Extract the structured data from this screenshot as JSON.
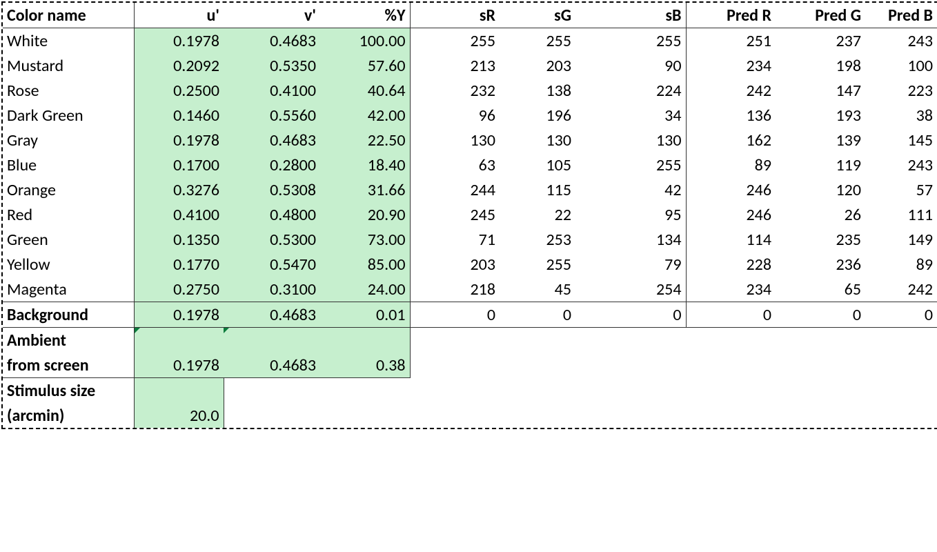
{
  "chart_data": {
    "type": "table",
    "headers": [
      "Color name",
      "u'",
      "v'",
      "%Y",
      "sR",
      "sG",
      "sB",
      "Pred R",
      "Pred G",
      "Pred B"
    ],
    "rows": [
      {
        "name": "White",
        "u": "0.1978",
        "v": "0.4683",
        "y": "100.00",
        "sR": "255",
        "sG": "255",
        "sB": "255",
        "pR": "251",
        "pG": "237",
        "pB": "243"
      },
      {
        "name": "Mustard",
        "u": "0.2092",
        "v": "0.5350",
        "y": "57.60",
        "sR": "213",
        "sG": "203",
        "sB": "90",
        "pR": "234",
        "pG": "198",
        "pB": "100"
      },
      {
        "name": "Rose",
        "u": "0.2500",
        "v": "0.4100",
        "y": "40.64",
        "sR": "232",
        "sG": "138",
        "sB": "224",
        "pR": "242",
        "pG": "147",
        "pB": "223"
      },
      {
        "name": "Dark Green",
        "u": "0.1460",
        "v": "0.5560",
        "y": "42.00",
        "sR": "96",
        "sG": "196",
        "sB": "34",
        "pR": "136",
        "pG": "193",
        "pB": "38"
      },
      {
        "name": "Gray",
        "u": "0.1978",
        "v": "0.4683",
        "y": "22.50",
        "sR": "130",
        "sG": "130",
        "sB": "130",
        "pR": "162",
        "pG": "139",
        "pB": "145"
      },
      {
        "name": "Blue",
        "u": "0.1700",
        "v": "0.2800",
        "y": "18.40",
        "sR": "63",
        "sG": "105",
        "sB": "255",
        "pR": "89",
        "pG": "119",
        "pB": "243"
      },
      {
        "name": "Orange",
        "u": "0.3276",
        "v": "0.5308",
        "y": "31.66",
        "sR": "244",
        "sG": "115",
        "sB": "42",
        "pR": "246",
        "pG": "120",
        "pB": "57"
      },
      {
        "name": "Red",
        "u": "0.4100",
        "v": "0.4800",
        "y": "20.90",
        "sR": "245",
        "sG": "22",
        "sB": "95",
        "pR": "246",
        "pG": "26",
        "pB": "111"
      },
      {
        "name": "Green",
        "u": "0.1350",
        "v": "0.5300",
        "y": "73.00",
        "sR": "71",
        "sG": "253",
        "sB": "134",
        "pR": "114",
        "pG": "235",
        "pB": "149"
      },
      {
        "name": "Yellow",
        "u": "0.1770",
        "v": "0.5470",
        "y": "85.00",
        "sR": "203",
        "sG": "255",
        "sB": "79",
        "pR": "228",
        "pG": "236",
        "pB": "89"
      },
      {
        "name": "Magenta",
        "u": "0.2750",
        "v": "0.3100",
        "y": "24.00",
        "sR": "218",
        "sG": "45",
        "sB": "254",
        "pR": "234",
        "pG": "65",
        "pB": "242"
      }
    ],
    "background": {
      "name": "Background",
      "u": "0.1978",
      "v": "0.4683",
      "y": "0.01",
      "sR": "0",
      "sG": "0",
      "sB": "0",
      "pR": "0",
      "pG": "0",
      "pB": "0"
    },
    "ambient": {
      "name_l1": "Ambient",
      "name_l2": "from screen",
      "u": "0.1978",
      "v": "0.4683",
      "y": "0.38"
    },
    "stimulus": {
      "name_l1": "Stimulus size",
      "name_l2": "(arcmin)",
      "value": "20.0"
    }
  }
}
